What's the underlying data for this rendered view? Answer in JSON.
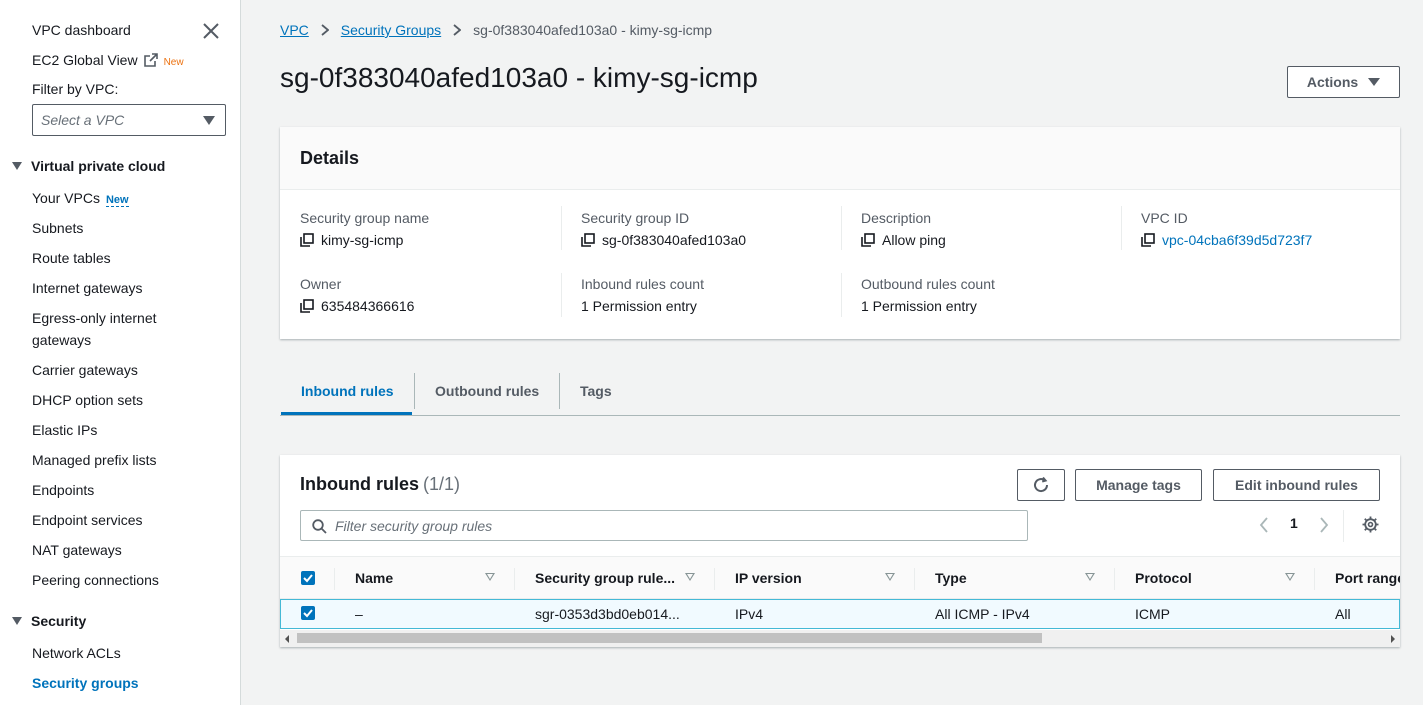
{
  "sidebar": {
    "dashboard": "VPC dashboard",
    "global_view": "EC2 Global View",
    "global_view_badge": "New",
    "filter_label": "Filter by VPC:",
    "filter_placeholder": "Select a VPC",
    "section_vpc": "Virtual private cloud",
    "vpc_items": [
      {
        "label": "Your VPCs",
        "badge": "New"
      },
      {
        "label": "Subnets"
      },
      {
        "label": "Route tables"
      },
      {
        "label": "Internet gateways"
      },
      {
        "label": "Egress-only internet gateways"
      },
      {
        "label": "Carrier gateways"
      },
      {
        "label": "DHCP option sets"
      },
      {
        "label": "Elastic IPs"
      },
      {
        "label": "Managed prefix lists"
      },
      {
        "label": "Endpoints"
      },
      {
        "label": "Endpoint services"
      },
      {
        "label": "NAT gateways"
      },
      {
        "label": "Peering connections"
      }
    ],
    "section_security": "Security",
    "security_items": [
      {
        "label": "Network ACLs"
      },
      {
        "label": "Security groups"
      }
    ]
  },
  "breadcrumb": {
    "root": "VPC",
    "parent": "Security Groups",
    "current": "sg-0f383040afed103a0 - kimy-sg-icmp"
  },
  "page": {
    "title": "sg-0f383040afed103a0 - kimy-sg-icmp",
    "actions_label": "Actions"
  },
  "details": {
    "heading": "Details",
    "sg_name_label": "Security group name",
    "sg_name": "kimy-sg-icmp",
    "sg_id_label": "Security group ID",
    "sg_id": "sg-0f383040afed103a0",
    "description_label": "Description",
    "description": "Allow ping",
    "vpc_id_label": "VPC ID",
    "vpc_id": "vpc-04cba6f39d5d723f7",
    "owner_label": "Owner",
    "owner": "635484366616",
    "inbound_count_label": "Inbound rules count",
    "inbound_count": "1 Permission entry",
    "outbound_count_label": "Outbound rules count",
    "outbound_count": "1 Permission entry"
  },
  "tabs": [
    "Inbound rules",
    "Outbound rules",
    "Tags"
  ],
  "inbound": {
    "title": "Inbound rules",
    "count": "(1/1)",
    "manage_tags": "Manage tags",
    "edit_rules": "Edit inbound rules",
    "search_placeholder": "Filter security group rules",
    "page": "1",
    "columns": [
      "Name",
      "Security group rule...",
      "IP version",
      "Type",
      "Protocol",
      "Port range"
    ],
    "rows": [
      {
        "name": "–",
        "rule_id": "sgr-0353d3bd0eb014...",
        "ip_version": "IPv4",
        "type": "All ICMP - IPv4",
        "protocol": "ICMP",
        "port_range": "All"
      }
    ]
  }
}
